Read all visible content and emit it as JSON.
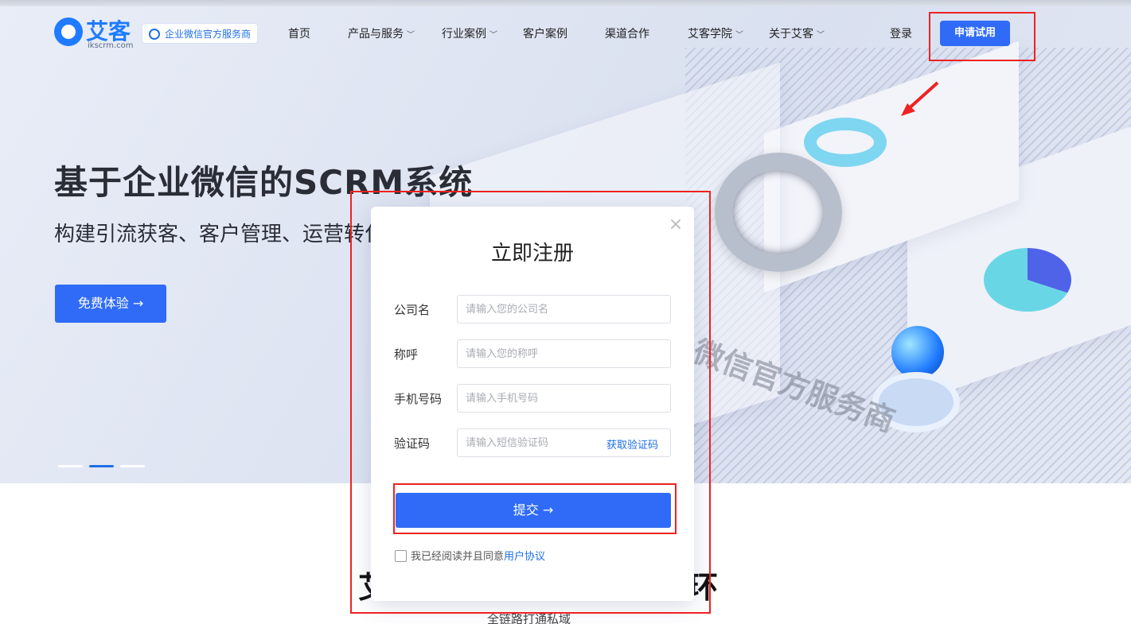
{
  "brand": {
    "logo_text": "艾客",
    "logo_sub": "ikscrm.com",
    "badge": "企业微信官方服务商",
    "colors": {
      "primary": "#2f6bf6",
      "highlight": "#e22222"
    }
  },
  "nav": {
    "items": [
      {
        "label": "首页",
        "has_dropdown": false
      },
      {
        "label": "产品与服务",
        "has_dropdown": true
      },
      {
        "label": "行业案例",
        "has_dropdown": true
      },
      {
        "label": "客户案例",
        "has_dropdown": false
      },
      {
        "label": "渠道合作",
        "has_dropdown": false
      },
      {
        "label": "艾客学院",
        "has_dropdown": true
      },
      {
        "label": "关于艾客",
        "has_dropdown": true
      }
    ],
    "login": "登录",
    "trial": "申请试用",
    "chevron": "﹀"
  },
  "hero": {
    "title": "基于企业微信的SCRM系统",
    "subtitle": "构建引流获客、客户管理、运营转化",
    "cta": "免费体验 →",
    "watermark": "微信官方服务商",
    "carousel": {
      "count": 3,
      "active": 1
    }
  },
  "section": {
    "title_left": "艾",
    "title_right": "环",
    "subtitle": "全链路打通私域"
  },
  "modal": {
    "close": "×",
    "title": "立即注册",
    "fields": [
      {
        "label": "公司名",
        "placeholder": "请输入您的公司名"
      },
      {
        "label": "称呼",
        "placeholder": "请输入您的称呼"
      },
      {
        "label": "手机号码",
        "placeholder": "请输入手机号码"
      },
      {
        "label": "验证码",
        "placeholder": "请输入短信验证码"
      }
    ],
    "get_code": "获取验证码",
    "submit": "提交 →",
    "agree_text": "我已经阅读并且同意",
    "agree_link": "用户协议"
  }
}
